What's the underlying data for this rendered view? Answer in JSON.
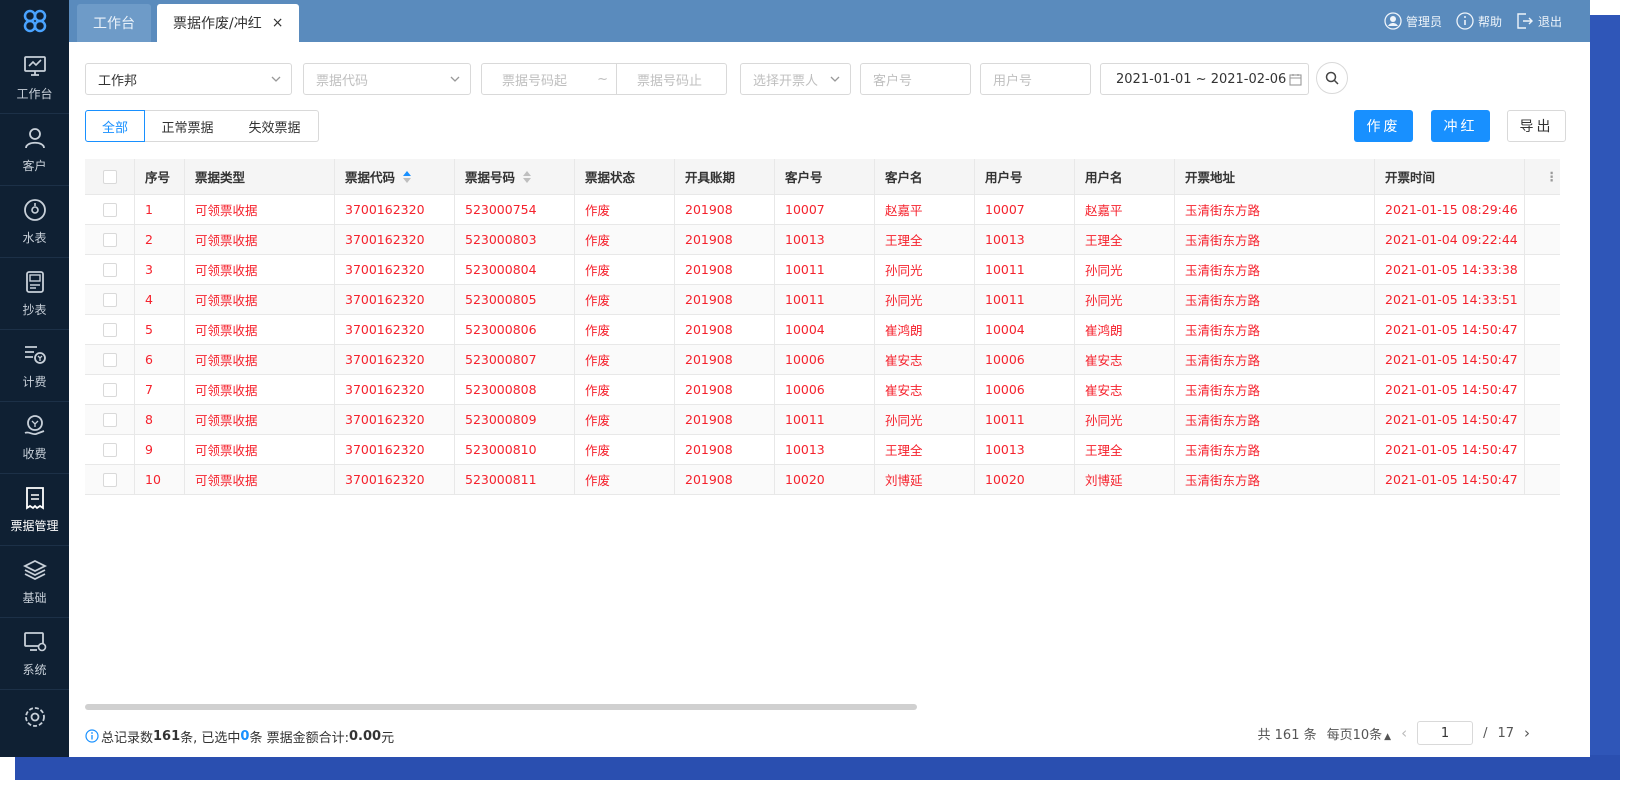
{
  "sidebar": {
    "items": [
      {
        "label": "工作台",
        "icon": "monitor-icon"
      },
      {
        "label": "客户",
        "icon": "user-icon"
      },
      {
        "label": "水表",
        "icon": "meter-icon"
      },
      {
        "label": "抄表",
        "icon": "reader-icon"
      },
      {
        "label": "计费",
        "icon": "billing-icon"
      },
      {
        "label": "收费",
        "icon": "payment-icon"
      },
      {
        "label": "票据管理",
        "icon": "ticket-icon",
        "active": true
      },
      {
        "label": "基础",
        "icon": "layers-icon"
      },
      {
        "label": "系统",
        "icon": "system-icon"
      }
    ]
  },
  "tabs": {
    "home": "工作台",
    "active": "票据作废/冲红",
    "close": "×"
  },
  "topbar": {
    "admin": "管理员",
    "help": "帮助",
    "logout": "退出"
  },
  "filters": {
    "company": "工作邦",
    "code_placeholder": "票据代码",
    "num_start_placeholder": "票据号码起",
    "tilde": "~",
    "num_end_placeholder": "票据号码止",
    "issuer_placeholder": "选择开票人",
    "customer_placeholder": "客户号",
    "user_placeholder": "用户号",
    "date_range": "2021-01-01 ~ 2021-02-06"
  },
  "segments": {
    "all": "全部",
    "normal": "正常票据",
    "invalid": "失效票据"
  },
  "buttons": {
    "void": "作废",
    "red": "冲红",
    "export": "导出"
  },
  "table": {
    "headers": [
      "序号",
      "票据类型",
      "票据代码",
      "票据号码",
      "票据状态",
      "开具账期",
      "客户号",
      "客户名",
      "用户号",
      "用户名",
      "开票地址",
      "开票时间"
    ],
    "rows": [
      [
        "1",
        "可领票收据",
        "3700162320",
        "523000754",
        "作废",
        "201908",
        "10007",
        "赵嘉平",
        "10007",
        "赵嘉平",
        "玉清街东方路",
        "2021-01-15 08:29:46"
      ],
      [
        "2",
        "可领票收据",
        "3700162320",
        "523000803",
        "作废",
        "201908",
        "10013",
        "王理全",
        "10013",
        "王理全",
        "玉清街东方路",
        "2021-01-04 09:22:44"
      ],
      [
        "3",
        "可领票收据",
        "3700162320",
        "523000804",
        "作废",
        "201908",
        "10011",
        "孙同光",
        "10011",
        "孙同光",
        "玉清街东方路",
        "2021-01-05 14:33:38"
      ],
      [
        "4",
        "可领票收据",
        "3700162320",
        "523000805",
        "作废",
        "201908",
        "10011",
        "孙同光",
        "10011",
        "孙同光",
        "玉清街东方路",
        "2021-01-05 14:33:51"
      ],
      [
        "5",
        "可领票收据",
        "3700162320",
        "523000806",
        "作废",
        "201908",
        "10004",
        "崔鸿朗",
        "10004",
        "崔鸿朗",
        "玉清街东方路",
        "2021-01-05 14:50:47"
      ],
      [
        "6",
        "可领票收据",
        "3700162320",
        "523000807",
        "作废",
        "201908",
        "10006",
        "崔安志",
        "10006",
        "崔安志",
        "玉清街东方路",
        "2021-01-05 14:50:47"
      ],
      [
        "7",
        "可领票收据",
        "3700162320",
        "523000808",
        "作废",
        "201908",
        "10006",
        "崔安志",
        "10006",
        "崔安志",
        "玉清街东方路",
        "2021-01-05 14:50:47"
      ],
      [
        "8",
        "可领票收据",
        "3700162320",
        "523000809",
        "作废",
        "201908",
        "10011",
        "孙同光",
        "10011",
        "孙同光",
        "玉清街东方路",
        "2021-01-05 14:50:47"
      ],
      [
        "9",
        "可领票收据",
        "3700162320",
        "523000810",
        "作废",
        "201908",
        "10013",
        "王理全",
        "10013",
        "王理全",
        "玉清街东方路",
        "2021-01-05 14:50:47"
      ],
      [
        "10",
        "可领票收据",
        "3700162320",
        "523000811",
        "作废",
        "201908",
        "10020",
        "刘博延",
        "10020",
        "刘博延",
        "玉清街东方路",
        "2021-01-05 14:50:47"
      ]
    ]
  },
  "summary": {
    "prefix": "总记录数",
    "total": "161",
    "mid1": "条, 已选中",
    "selected": "0",
    "mid2": "条 票据金额合计:",
    "amount": "0.00",
    "suffix": "元"
  },
  "pager": {
    "total_text": "共 161 条",
    "page_size": "每页10条",
    "current": "1",
    "slash": "/",
    "pages": "17"
  },
  "colors": {
    "accent": "#1890ff",
    "danger": "#f5222d",
    "sidebar": "#0f2033",
    "header": "#5a8bbd"
  }
}
